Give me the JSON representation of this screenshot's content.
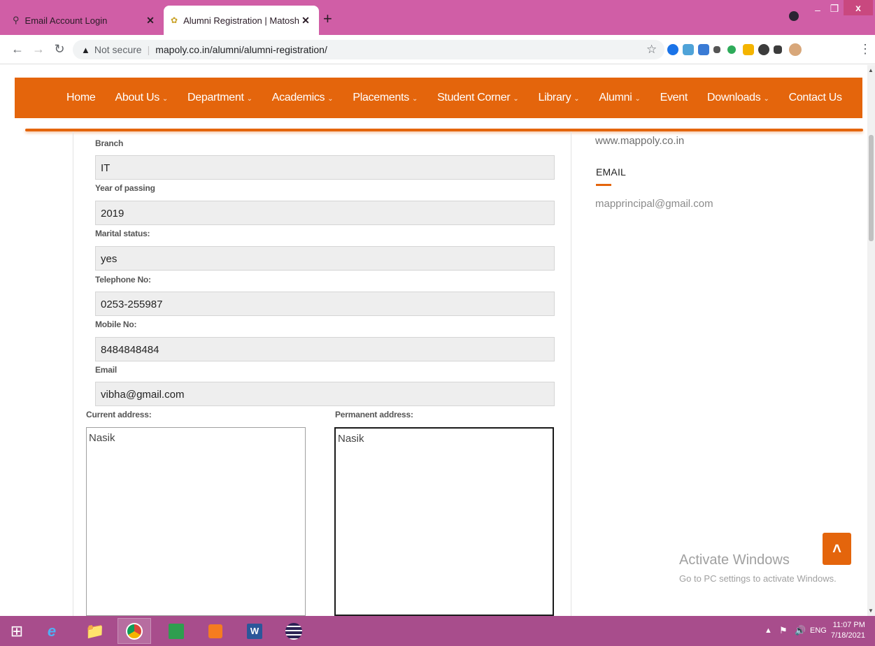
{
  "browser": {
    "tabs": [
      {
        "title": "Email Account Login",
        "active": false
      },
      {
        "title": "Alumni Registration | Matoshri Ac",
        "active": true
      }
    ],
    "security_label": "Not secure",
    "url": "mapoly.co.in/alumni/alumni-registration/"
  },
  "nav": {
    "items": [
      {
        "label": "Home",
        "has_menu": false
      },
      {
        "label": "About Us",
        "has_menu": true
      },
      {
        "label": "Department",
        "has_menu": true
      },
      {
        "label": "Academics",
        "has_menu": true
      },
      {
        "label": "Placements",
        "has_menu": true
      },
      {
        "label": "Student Corner",
        "has_menu": true
      },
      {
        "label": "Library",
        "has_menu": true
      },
      {
        "label": "Alumni",
        "has_menu": true
      },
      {
        "label": "Event",
        "has_menu": false
      },
      {
        "label": "Downloads",
        "has_menu": true
      },
      {
        "label": "Contact Us",
        "has_menu": false
      }
    ],
    "chevron": "⌄"
  },
  "form": {
    "fields": [
      {
        "label": "Branch",
        "value": "IT"
      },
      {
        "label": "Year of passing",
        "value": "2019"
      },
      {
        "label": "Marital status:",
        "value": "yes"
      },
      {
        "label": "Telephone No:",
        "value": "0253-255987"
      },
      {
        "label": "Mobile No:",
        "value": "8484848484"
      },
      {
        "label": "Email",
        "value": "vibha@gmail.com"
      }
    ],
    "current_address": {
      "label": "Current address:",
      "value": "Nasik"
    },
    "permanent_address": {
      "label": "Permanent address:",
      "value": "Nasik"
    }
  },
  "sidebar": {
    "website": "www.mappoly.co.in",
    "email_heading": "EMAIL",
    "email": "mapprincipal@gmail.com"
  },
  "watermark": {
    "title": "Activate Windows",
    "subtitle": "Go to PC settings to activate Windows."
  },
  "taskbar": {
    "language": "ENG",
    "time": "11:07 PM",
    "date": "7/18/2021"
  },
  "colors": {
    "accent": "#e4650c",
    "tabbar": "#d05ea6",
    "taskbar": "#a84d8c"
  }
}
